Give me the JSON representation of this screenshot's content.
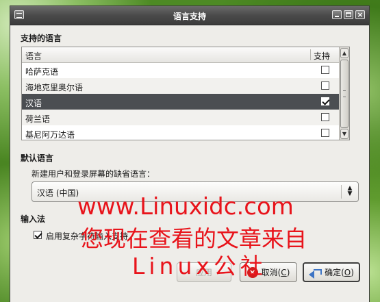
{
  "window": {
    "title": "语言支持"
  },
  "supported": {
    "section_title": "支持的语言",
    "col_language": "语言",
    "col_support": "支持",
    "rows": [
      {
        "label": "哈萨克语",
        "checked": false,
        "selected": false
      },
      {
        "label": "海地克里奥尔语",
        "checked": false,
        "selected": false
      },
      {
        "label": "汉语",
        "checked": true,
        "selected": true
      },
      {
        "label": "荷兰语",
        "checked": false,
        "selected": false
      },
      {
        "label": "基尼阿万达语",
        "checked": false,
        "selected": false
      }
    ]
  },
  "default_lang": {
    "section_title": "默认语言",
    "hint": "新建用户和登录屏幕的缺省语言：",
    "selected_value": "汉语 (中国)"
  },
  "input_method": {
    "section_title": "输入法",
    "checkbox_label": "启用复杂字符输入支持",
    "checked": true
  },
  "buttons": {
    "apply": "应用",
    "cancel": "取消(C)",
    "cancel_text": "取消(",
    "cancel_key": "C",
    "ok_text": "确定(",
    "ok_key": "O"
  },
  "watermark": {
    "line1": "www.Linuxidc.com",
    "line2": "您现在查看的文章来自",
    "line3": "Linux公社"
  }
}
